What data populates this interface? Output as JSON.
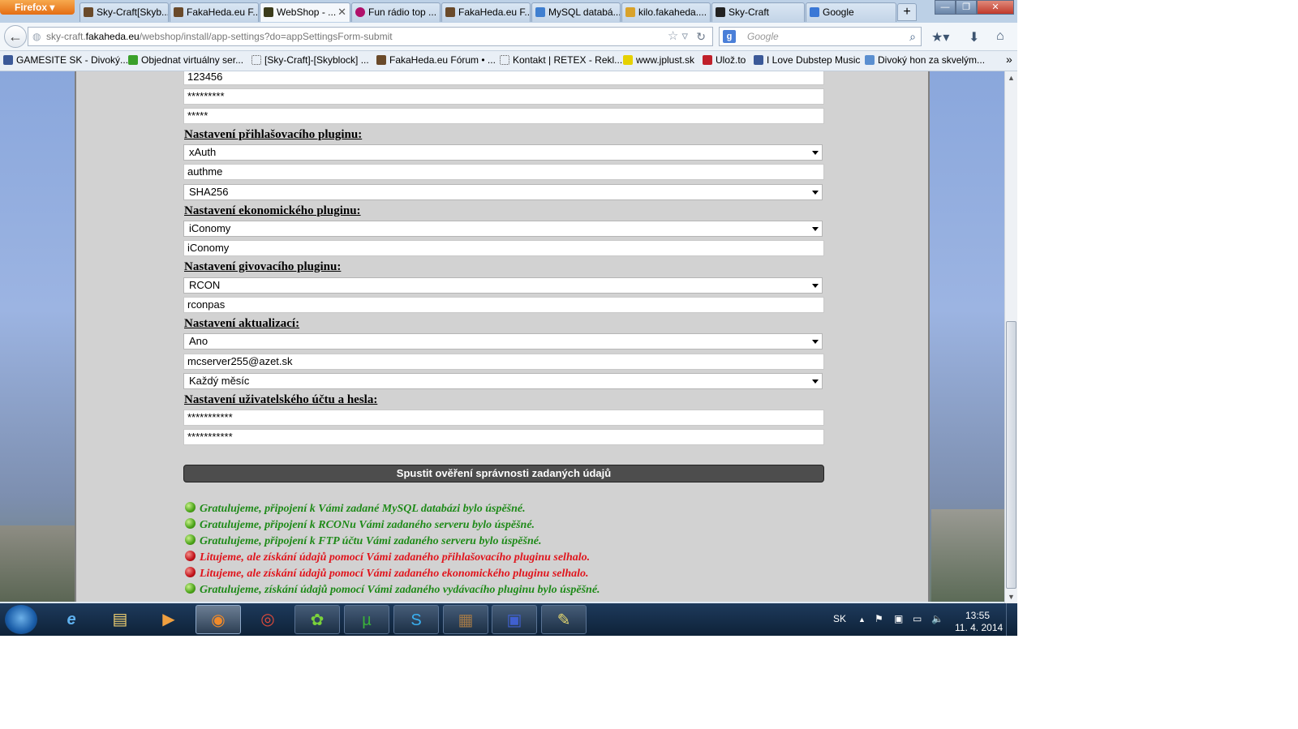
{
  "browser": {
    "menu_button": "Firefox",
    "tabs": [
      {
        "label": "Sky-Craft[Skyb...",
        "icon": "page-icon",
        "color": "#6a4a2a"
      },
      {
        "label": "FakaHeda.eu F...",
        "icon": "page-icon",
        "color": "#6a4a2a"
      },
      {
        "label": "WebShop - ...",
        "icon": "webshop-icon",
        "color": "#3b3b1b",
        "active": true
      },
      {
        "label": "Fun rádio top ...",
        "icon": "radio-icon",
        "color": "#b0106a"
      },
      {
        "label": "FakaHeda.eu F...",
        "icon": "page-icon",
        "color": "#6a4a2a"
      },
      {
        "label": "MySQL databá...",
        "icon": "db-icon",
        "color": "#3f7fd0"
      },
      {
        "label": "kilo.fakaheda....",
        "icon": "pma-icon",
        "color": "#d9a22a"
      },
      {
        "label": "Sky-Craft",
        "icon": "skycraft-icon",
        "color": "#222222"
      },
      {
        "label": "Google",
        "icon": "google-icon",
        "color": "#3a78d6"
      }
    ],
    "new_tab": "+",
    "url_prefix": "sky-craft.",
    "url_domain": "fakaheda.eu",
    "url_path": "/webshop/install/app-settings?do=appSettingsForm-submit",
    "search_placeholder": "Google",
    "bookmarks": [
      {
        "label": "GAMESITE SK - Divoký...",
        "color": "#3b5998"
      },
      {
        "label": "Objednat virtuálny ser...",
        "color": "#3aa02a"
      },
      {
        "label": "[Sky-Craft]-[Skyblock] ...",
        "color": "#ffffff"
      },
      {
        "label": "FakaHeda.eu Fórum • ...",
        "color": "#6a4a2a"
      },
      {
        "label": "Kontakt | RETEX - Rekl...",
        "color": "#ffffff"
      },
      {
        "label": "www.jplust.sk",
        "color": "#e6d100"
      },
      {
        "label": "Ulož.to",
        "color": "#c0202a"
      },
      {
        "label": "I Love Dubstep Music",
        "color": "#3b5998"
      },
      {
        "label": "Divoký hon za skvelým...",
        "color": "#5a8fd0"
      }
    ],
    "bookmarks_more": "»"
  },
  "form": {
    "top_fields": [
      "123456",
      "*********",
      "*****"
    ],
    "login_plugin": {
      "heading": "Nastavení přihlašovacího pluginu:",
      "plugin_select": "xAuth",
      "table_field": "authme",
      "hash_select": "SHA256"
    },
    "economy_plugin": {
      "heading": "Nastavení ekonomického pluginu:",
      "plugin_select": "iConomy",
      "name_field": "iConomy"
    },
    "give_plugin": {
      "heading": "Nastavení givovacího pluginu:",
      "plugin_select": "RCON",
      "password_field": "rconpas"
    },
    "updates": {
      "heading": "Nastavení aktualizací:",
      "enabled_select": "Ano",
      "email_field": "mcserver255@azet.sk",
      "frequency_select": "Každý měsíc"
    },
    "account": {
      "heading": "Nastavení uživatelského účtu a hesla:",
      "password_field": "***********",
      "password_confirm_field": "***********"
    },
    "verify_button": "Spustit ověření správnosti zadaných údajů"
  },
  "results": [
    {
      "status": "ok",
      "text": "Gratulujeme, připojení k Vámi zadané MySQL databázi bylo úspěšné."
    },
    {
      "status": "ok",
      "text": "Gratulujeme, připojení k RCONu Vámi zadaného serveru bylo úspěšné."
    },
    {
      "status": "ok",
      "text": "Gratulujeme, připojení k FTP účtu Vámi zadaného serveru bylo úspěšné."
    },
    {
      "status": "fail",
      "text": "Litujeme, ale získání údajů pomocí Vámi zadaného přihlašovacího pluginu selhalo."
    },
    {
      "status": "fail",
      "text": "Litujeme, ale získání údajů pomocí Vámi zadaného ekonomického pluginu selhalo."
    },
    {
      "status": "ok",
      "text": "Gratulujeme, získání údajů pomocí Vámi zadaného vydávacího pluginu bylo úspěšné."
    }
  ],
  "colors": {
    "success": "#1e8a18",
    "failure": "#e0141c",
    "button_bg": "#4d4d4d"
  },
  "taskbar": {
    "apps": [
      "start-icon",
      "internet-explorer-icon",
      "file-explorer-icon",
      "media-player-icon",
      "firefox-icon",
      "chrome-icon",
      "icq-icon",
      "utorrent-icon",
      "skype-icon",
      "minecraft-icon",
      "save-icon",
      "notepad-icon"
    ],
    "language": "SK",
    "time": "13:55",
    "date": "11. 4. 2014"
  }
}
